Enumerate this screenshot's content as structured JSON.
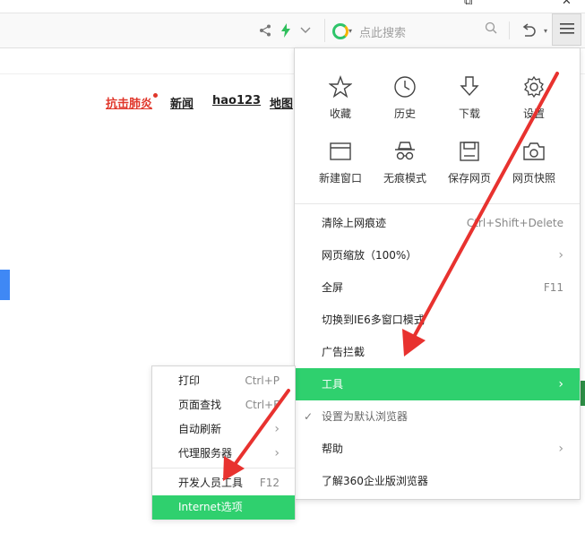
{
  "window": {
    "restore_glyph": "⧉",
    "close_glyph": "✕"
  },
  "toolbar": {
    "share_icon": "share-icon",
    "speed_icon": "lightning-icon",
    "dropdown_icon": "chevron-down-icon",
    "search": {
      "placeholder": "点此搜索"
    },
    "undo_icon": "undo-icon",
    "menu_icon": "hamburger-menu-icon"
  },
  "nav": {
    "links": [
      "抗击肺炎",
      "新闻",
      "hao123",
      "地图"
    ],
    "hot_color": "#e0362a"
  },
  "menu": {
    "grid": [
      {
        "label": "收藏",
        "icon": "star-icon"
      },
      {
        "label": "历史",
        "icon": "clock-icon"
      },
      {
        "label": "下载",
        "icon": "download-icon"
      },
      {
        "label": "设置",
        "icon": "gear-icon"
      },
      {
        "label": "新建窗口",
        "icon": "new-window-icon"
      },
      {
        "label": "无痕模式",
        "icon": "incognito-icon"
      },
      {
        "label": "保存网页",
        "icon": "save-page-icon"
      },
      {
        "label": "网页快照",
        "icon": "camera-icon"
      }
    ],
    "items": [
      {
        "label": "清除上网痕迹",
        "shortcut": "Ctrl+Shift+Delete"
      },
      {
        "label": "网页缩放（100%）",
        "arrow": "›"
      },
      {
        "label": "全屏",
        "shortcut": "F11"
      },
      {
        "label": "切换到IE6多窗口模式"
      },
      {
        "label": "广告拦截"
      },
      {
        "label": "工具",
        "arrow": "›"
      },
      {
        "label": "设置为默认浏览器",
        "check": "✓"
      },
      {
        "label": "帮助",
        "arrow": "›"
      },
      {
        "label": "了解360企业版浏览器"
      }
    ],
    "accent": "#2fd06e"
  },
  "submenu": {
    "items": [
      {
        "label": "打印",
        "shortcut": "Ctrl+P"
      },
      {
        "label": "页面查找",
        "shortcut": "Ctrl+F"
      },
      {
        "label": "自动刷新",
        "arrow": "›"
      },
      {
        "label": "代理服务器",
        "arrow": "›"
      },
      {
        "label": "开发人员工具",
        "shortcut": "F12"
      },
      {
        "label": "Internet选项"
      }
    ]
  },
  "annotation": {
    "arrow_color": "#e8322f"
  }
}
